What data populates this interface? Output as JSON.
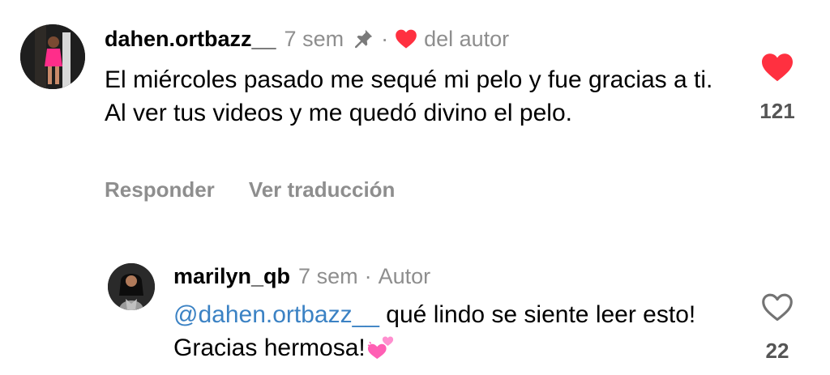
{
  "comments": [
    {
      "username": "dahen.ortbazz__",
      "time": "7 sem",
      "separator": "·",
      "author_badge": "del autor",
      "text": "El miércoles pasado me sequé mi pelo y fue gracias a ti. Al ver tus videos y me quedó divino el pelo.",
      "actions": {
        "reply": "Responder",
        "translate": "Ver traducción"
      },
      "likes": "121",
      "liked": true,
      "pinned": true,
      "liked_by_author": true
    },
    {
      "username": "marilyn_qb",
      "time": "7 sem",
      "separator": "·",
      "author_label": "Autor",
      "mention": "@dahen.ortbazz__",
      "text": " qué lindo se siente leer esto! Gracias hermosa!",
      "emoji": "two-hearts",
      "likes": "22",
      "liked": false
    }
  ],
  "colors": {
    "like_red": "#ff3040",
    "mention_blue": "#3b82c4",
    "muted_gray": "#8e8e8e",
    "emoji_pink": "#ff5fb4"
  },
  "icons": {
    "pin": "pin-icon",
    "author_heart": "heart-filled-icon",
    "like_filled": "heart-filled-icon",
    "like_outline": "heart-outline-icon",
    "emoji": "two-hearts-emoji"
  }
}
